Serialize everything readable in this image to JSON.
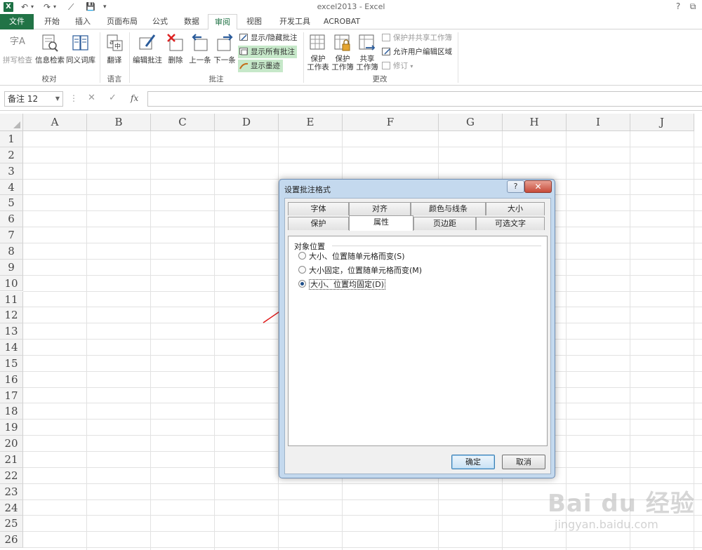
{
  "window": {
    "title": "excel2013 - Excel",
    "help": "?",
    "restore": "⧉",
    "qat": {
      "undo": "↶",
      "redo": "↷",
      "touch": "⟋",
      "save": "💾",
      "customize": "▾"
    }
  },
  "ribbon_tabs": [
    "文件",
    "开始",
    "插入",
    "页面布局",
    "公式",
    "数据",
    "审阅",
    "视图",
    "开发工具",
    "ACROBAT"
  ],
  "active_tab": "审阅",
  "ribbon": {
    "proofing": {
      "spell": "拼写检查",
      "research": "信息检索",
      "thesaurus": "同义词库",
      "group": "校对",
      "spell_icon_text": "字A"
    },
    "language": {
      "translate": "翻译",
      "group": "语言"
    },
    "comments": {
      "edit": "编辑批注",
      "delete": "删除",
      "prev": "上一条",
      "next": "下一条",
      "show_hide": "显示/隐藏批注",
      "show_all": "显示所有批注",
      "show_ink": "显示墨迹",
      "group": "批注"
    },
    "changes": {
      "protect_sheet": [
        "保护",
        "工作表"
      ],
      "protect_workbook": [
        "保护",
        "工作簿"
      ],
      "share_workbook": [
        "共享",
        "工作簿"
      ],
      "protect_share": "保护并共享工作簿",
      "allow_edit": "允许用户编辑区域",
      "track": "修订",
      "group": "更改"
    }
  },
  "formula_bar": {
    "name_box": "备注 12",
    "cancel": "✕",
    "enter": "✓",
    "fx": "fx",
    "options": "⋮"
  },
  "columns": [
    "A",
    "B",
    "C",
    "D",
    "E",
    "F",
    "G",
    "H",
    "I",
    "J"
  ],
  "rows": [
    "1",
    "2",
    "3",
    "4",
    "5",
    "6",
    "7",
    "8",
    "9",
    "10",
    "11",
    "12",
    "13",
    "14",
    "15",
    "16",
    "17",
    "18",
    "19",
    "20",
    "21",
    "22",
    "23",
    "24",
    "25",
    "26"
  ],
  "dialog": {
    "title": "设置批注格式",
    "help": "?",
    "close": "✕",
    "tabs_row1": [
      "字体",
      "对齐",
      "颜色与线条",
      "大小"
    ],
    "tabs_row2": [
      "保护",
      "属性",
      "页边距",
      "可选文字"
    ],
    "active_tab": "属性",
    "section": "对象位置",
    "options": [
      {
        "label": "大小、位置随单元格而变(S)",
        "checked": false
      },
      {
        "label": "大小固定，位置随单元格而变(M)",
        "checked": false
      },
      {
        "label": "大小、位置均固定(D)",
        "checked": true
      }
    ],
    "ok": "确定",
    "cancel": "取消"
  },
  "watermark": {
    "brand": "Bai du 经验",
    "url": "jingyan.baidu.com"
  },
  "colors": {
    "excel_green": "#217346",
    "dialog_frame": "#c4d9ee",
    "arrow": "#e01b1b",
    "highlight": "#c6e8c9"
  }
}
